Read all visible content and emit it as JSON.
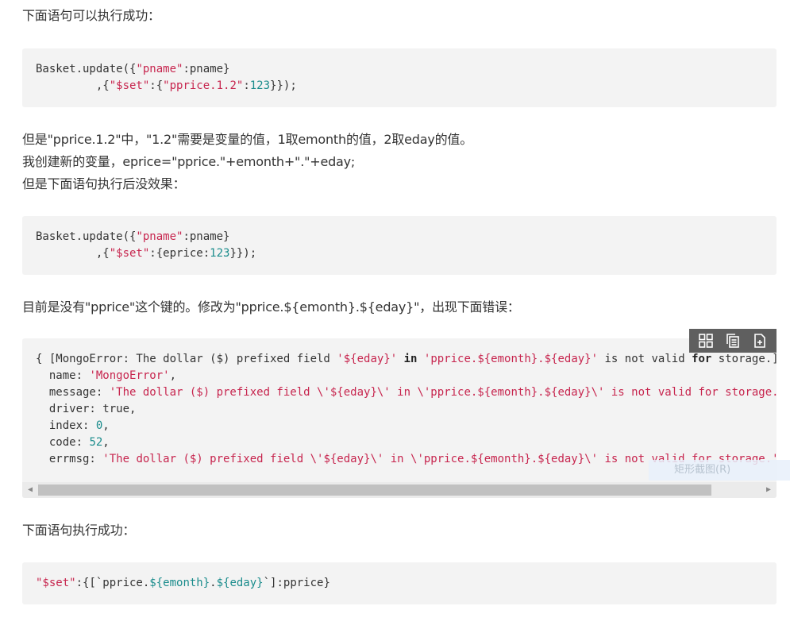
{
  "paragraphs": {
    "p1": "下面语句可以执行成功：",
    "p2": "但是\"pprice.1.2\"中，\"1.2\"需要是变量的值，1取emonth的值，2取eday的值。",
    "p3": "我创建新的变量，eprice=\"pprice.\"+emonth+\".\"+eday;",
    "p4": "但是下面语句执行后没效果：",
    "p5": "目前是没有\"pprice\"这个键的。修改为\"pprice.${emonth}.${eday}\"，出现下面错误：",
    "p6": "下面语句执行成功："
  },
  "code1": {
    "l1_a": "Basket.update({",
    "l1_b": "\"pname\"",
    "l1_c": ":pname}",
    "l2_a": "         ,{",
    "l2_b": "\"$set\"",
    "l2_c": ":{",
    "l2_d": "\"pprice.1.2\"",
    "l2_e": ":",
    "l2_f": "123",
    "l2_g": "}});"
  },
  "code2": {
    "l1_a": "Basket.update({",
    "l1_b": "\"pname\"",
    "l1_c": ":pname}",
    "l2_a": "         ,{",
    "l2_b": "\"$set\"",
    "l2_c": ":{eprice:",
    "l2_d": "123",
    "l2_e": "}});"
  },
  "code3": {
    "l1_a": "{ [MongoError: The dollar ($) prefixed field ",
    "l1_b": "'${eday}'",
    "l1_c": " ",
    "l1_kw1": "in",
    "l1_d": " ",
    "l1_e": "'pprice.${emonth}.${eday}'",
    "l1_f": " is not valid ",
    "l1_kw2": "for",
    "l1_g": " storage.]",
    "l2_a": "  name: ",
    "l2_b": "'MongoError'",
    "l2_c": ",",
    "l3_a": "  message: ",
    "l3_b": "'The dollar ($) prefixed field \\'${eday}\\' in \\'pprice.${emonth}.${eday}\\' is not valid for storage.'",
    "l3_c": ",",
    "l4_a": "  driver: true,",
    "l5_a": "  index: ",
    "l5_b": "0",
    "l5_c": ",",
    "l6_a": "  code: ",
    "l6_b": "52",
    "l6_c": ",",
    "l7_a": "  errmsg: ",
    "l7_b": "'The dollar ($) prefixed field \\'${eday}\\' in \\'pprice.${emonth}.${eday}\\' is not valid for storage.'"
  },
  "code4": {
    "l1_a": "\"$set\"",
    "l1_b": ":{[`pprice.",
    "l1_c": "${emonth}",
    "l1_d": ".",
    "l1_e": "${eday}",
    "l1_f": "`]:pprice}"
  },
  "toolbar": {
    "icons": [
      "view-source-icon",
      "copy-icon",
      "print-icon"
    ]
  },
  "tooltip": {
    "text": "矩形截图(R)"
  },
  "colors": {
    "string": "#c7254e",
    "number": "#1a8c8c",
    "code_bg": "#f3f3f3",
    "toolbar_bg": "#5f5f5f"
  }
}
